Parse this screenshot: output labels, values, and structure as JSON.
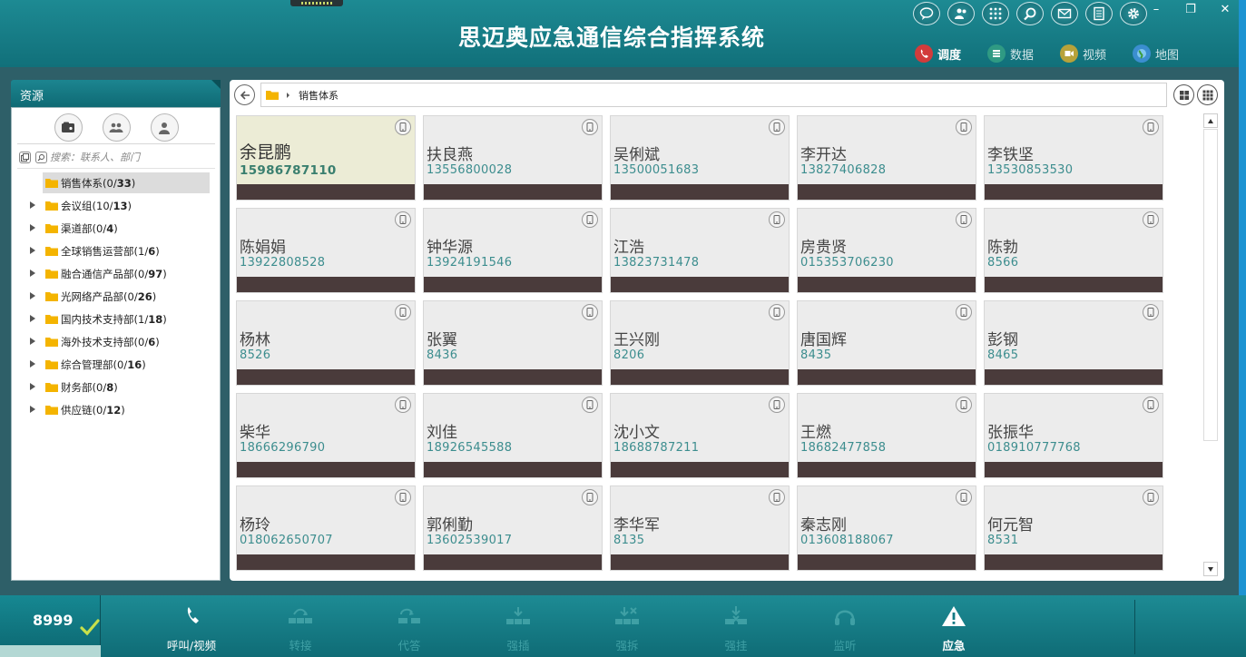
{
  "app": {
    "title": "思迈奥应急通信综合指挥系统",
    "accent_color": "#137a84",
    "dark_bar_color": "#4a3b3b"
  },
  "header_icons": [
    "chat-icon",
    "contacts-icon",
    "dialpad-icon",
    "search-icon",
    "mail-icon",
    "notes-icon",
    "settings-icon"
  ],
  "window_controls": {
    "minimize": "–",
    "restore": "❐",
    "close": "✕"
  },
  "mode_tabs": [
    {
      "label": "调度",
      "icon": "dispatch-icon",
      "active": true,
      "color": "#d23b3b"
    },
    {
      "label": "数据",
      "icon": "data-icon",
      "active": false,
      "color": "#2f9a83"
    },
    {
      "label": "视频",
      "icon": "video-icon",
      "active": false,
      "color": "#b7a23a"
    },
    {
      "label": "地图",
      "icon": "globe-icon",
      "active": false,
      "color": "#3b8ed0"
    }
  ],
  "sidebar": {
    "title": "资源",
    "tabs": [
      "organization-icon",
      "group-icon",
      "person-icon"
    ],
    "search_placeholder": "搜索：联系人、部门",
    "tree": [
      {
        "name": "销售体系",
        "online": "0",
        "total": "33",
        "selected": true,
        "expandable": false
      },
      {
        "name": "会议组",
        "online": "10",
        "total": "13",
        "selected": false,
        "expandable": true
      },
      {
        "name": "渠道部",
        "online": "0",
        "total": "4",
        "selected": false,
        "expandable": true
      },
      {
        "name": "全球销售运营部",
        "online": "1",
        "total": "6",
        "selected": false,
        "expandable": true
      },
      {
        "name": "融合通信产品部",
        "online": "0",
        "total": "97",
        "selected": false,
        "expandable": true
      },
      {
        "name": "光网络产品部",
        "online": "0",
        "total": "26",
        "selected": false,
        "expandable": true
      },
      {
        "name": "国内技术支持部",
        "online": "1",
        "total": "18",
        "selected": false,
        "expandable": true
      },
      {
        "name": "海外技术支持部",
        "online": "0",
        "total": "6",
        "selected": false,
        "expandable": true
      },
      {
        "name": "综合管理部",
        "online": "0",
        "total": "16",
        "selected": false,
        "expandable": true
      },
      {
        "name": "财务部",
        "online": "0",
        "total": "8",
        "selected": false,
        "expandable": true
      },
      {
        "name": "供应链",
        "online": "0",
        "total": "12",
        "selected": false,
        "expandable": true
      }
    ]
  },
  "main": {
    "breadcrumb": "销售体系",
    "contacts": [
      {
        "name": "余昆鹏",
        "number": "15986787110",
        "highlight": true
      },
      {
        "name": "扶良燕",
        "number": "13556800028"
      },
      {
        "name": "吴俐斌",
        "number": "13500051683"
      },
      {
        "name": "李开达",
        "number": "13827406828"
      },
      {
        "name": "李铁坚",
        "number": "13530853530"
      },
      {
        "name": "陈娟娟",
        "number": "13922808528"
      },
      {
        "name": "钟华源",
        "number": "13924191546"
      },
      {
        "name": "江浩",
        "number": "13823731478"
      },
      {
        "name": "房贵贤",
        "number": "015353706230"
      },
      {
        "name": "陈勃",
        "number": "8566"
      },
      {
        "name": "杨林",
        "number": "8526"
      },
      {
        "name": "张翼",
        "number": "8436"
      },
      {
        "name": "王兴刚",
        "number": "8206"
      },
      {
        "name": "唐国辉",
        "number": "8435"
      },
      {
        "name": "彭钢",
        "number": "8465"
      },
      {
        "name": "柴华",
        "number": "18666296790"
      },
      {
        "name": "刘佳",
        "number": "18926545588"
      },
      {
        "name": "沈小文",
        "number": "18688787211"
      },
      {
        "name": "王燃",
        "number": "18682477858"
      },
      {
        "name": "张振华",
        "number": "018910777768"
      },
      {
        "name": "杨玲",
        "number": "018062650707"
      },
      {
        "name": "郭俐勤",
        "number": "13602539017"
      },
      {
        "name": "李华军",
        "number": "8135"
      },
      {
        "name": "秦志刚",
        "number": "013608188067"
      },
      {
        "name": "何元智",
        "number": "8531"
      }
    ]
  },
  "bottom_bar": {
    "extension": "8999",
    "status_icon": "check-icon",
    "actions": [
      {
        "label": "呼叫/视频",
        "icon": "phone-call-icon",
        "enabled": true
      },
      {
        "label": "转接",
        "icon": "transfer-icon",
        "enabled": false
      },
      {
        "label": "代答",
        "icon": "pickup-icon",
        "enabled": false
      },
      {
        "label": "强插",
        "icon": "barge-in-icon",
        "enabled": false
      },
      {
        "label": "强拆",
        "icon": "force-release-icon",
        "enabled": false
      },
      {
        "label": "强挂",
        "icon": "force-hangup-icon",
        "enabled": false
      },
      {
        "label": "监听",
        "icon": "monitor-icon",
        "enabled": false
      },
      {
        "label": "应急",
        "icon": "emergency-icon",
        "enabled": true
      }
    ]
  }
}
